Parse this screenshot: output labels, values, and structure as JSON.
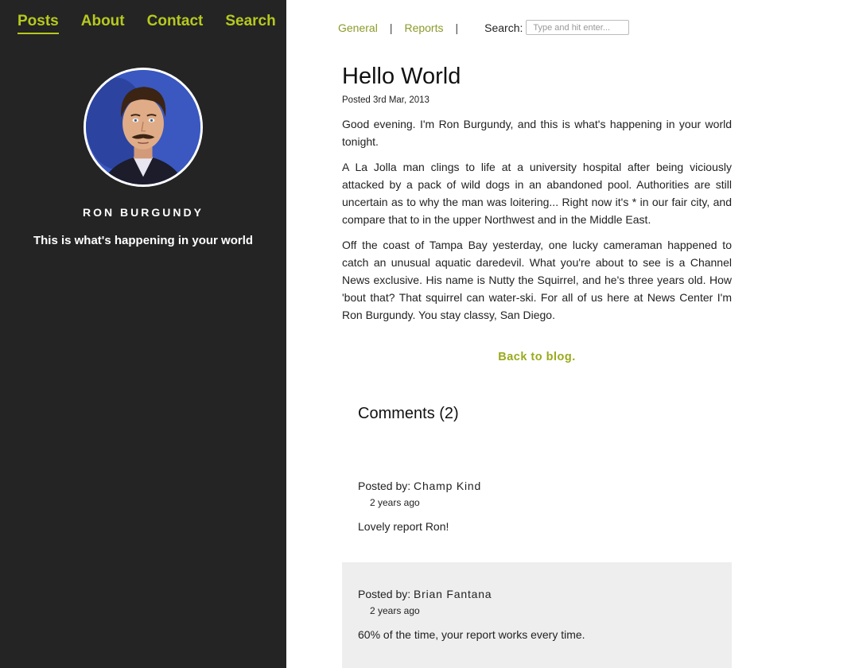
{
  "nav": {
    "items": [
      {
        "label": "Posts",
        "active": true
      },
      {
        "label": "About",
        "active": false
      },
      {
        "label": "Contact",
        "active": false
      },
      {
        "label": "Search",
        "active": false
      }
    ]
  },
  "profile": {
    "name": "RON BURGUNDY",
    "tagline": "This is what's happening in your world"
  },
  "subnav": {
    "links": [
      "General",
      "Reports"
    ],
    "separator": "|",
    "search_label": "Search:",
    "search_placeholder": "Type and hit enter..."
  },
  "post": {
    "title": "Hello World",
    "date": "Posted 3rd Mar, 2013",
    "paragraphs": [
      "Good evening. I'm Ron Burgundy, and this is what's happening in your world tonight.",
      "A La Jolla man clings to life at a university hospital after being viciously attacked by a pack of wild dogs in an abandoned pool. Authorities are still uncertain as to why the man was loitering... Right now it's * in our fair city, and compare that to in the upper Northwest and in the Middle East.",
      "Off the coast of Tampa Bay yesterday, one lucky cameraman happened to catch an unusual aquatic daredevil. What you're about to see is a Channel News exclusive. His name is Nutty the Squirrel, and he's three years old. How 'bout that? That squirrel can water-ski. For all of us here at News Center I'm Ron Burgundy. You stay classy, San Diego."
    ],
    "back_link": "Back to blog."
  },
  "comments": {
    "heading": "Comments (2)",
    "posted_by_label": "Posted by:",
    "items": [
      {
        "author": "Champ Kind",
        "ago": "2 years ago",
        "text": "Lovely report Ron!"
      },
      {
        "author": "Brian Fantana",
        "ago": "2 years ago",
        "text": "60% of the time, your report works every time."
      }
    ]
  },
  "colors": {
    "accent": "#b6c91e",
    "link": "#8c9a2a",
    "sidebar_bg": "#242424",
    "alt_comment_bg": "#eeeeee"
  }
}
